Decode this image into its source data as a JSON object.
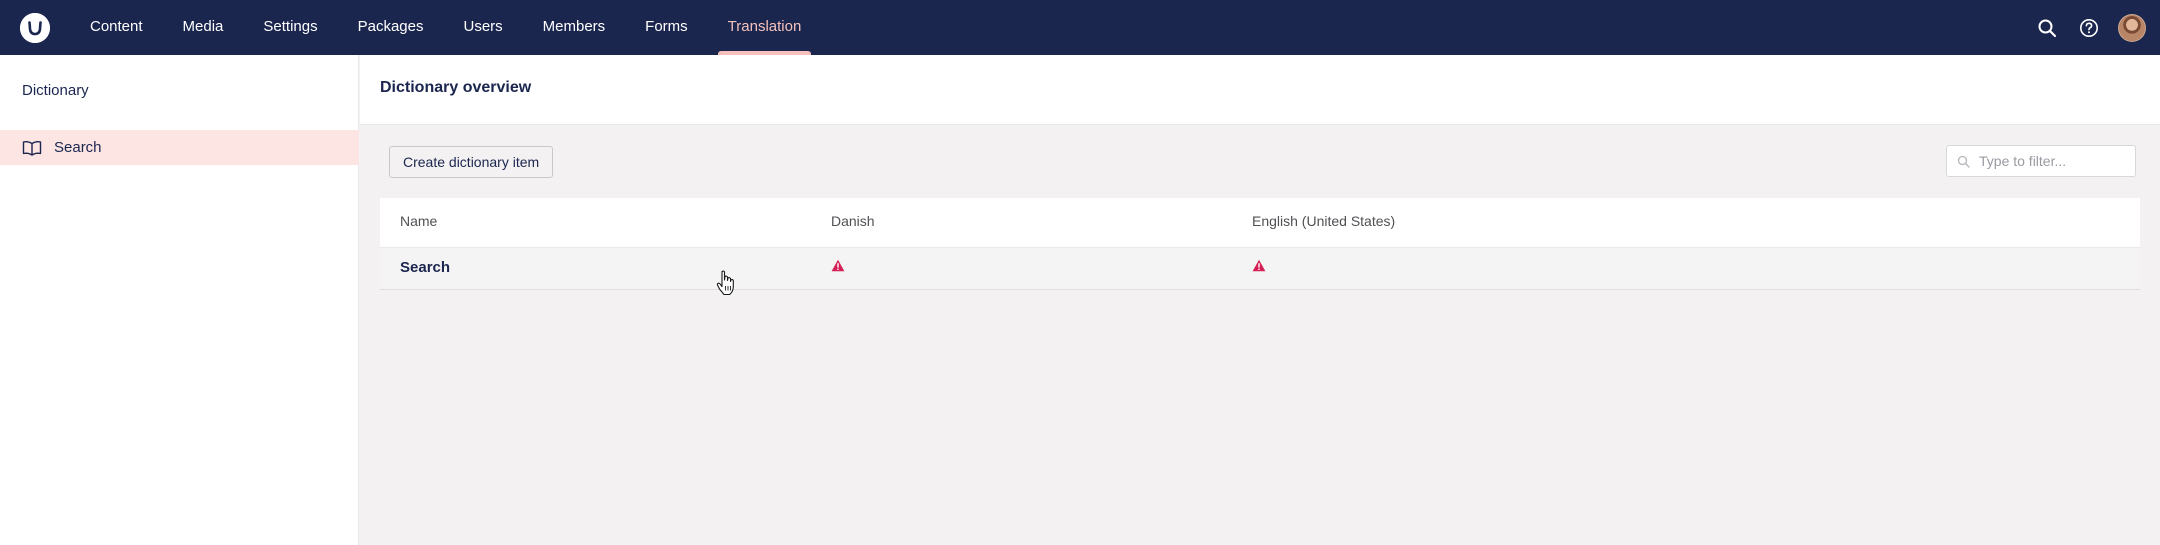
{
  "topbar": {
    "logo_icon": "umbraco-logo-icon",
    "nav": [
      {
        "label": "Content"
      },
      {
        "label": "Media"
      },
      {
        "label": "Settings"
      },
      {
        "label": "Packages"
      },
      {
        "label": "Users"
      },
      {
        "label": "Members"
      },
      {
        "label": "Forms"
      },
      {
        "label": "Translation",
        "active": true
      }
    ],
    "icons": [
      "search-icon",
      "help-icon",
      "avatar"
    ]
  },
  "sidebar": {
    "title": "Dictionary",
    "items": [
      {
        "label": "Search",
        "icon": "book-icon",
        "selected": true
      }
    ]
  },
  "main": {
    "title": "Dictionary overview",
    "create_button": "Create dictionary item",
    "filter": {
      "placeholder": "Type to filter...",
      "value": ""
    },
    "table": {
      "columns": [
        "Name",
        "Danish",
        "English (United States)"
      ],
      "rows": [
        {
          "name": "Search",
          "danish": "warning-icon",
          "english": "warning-icon"
        }
      ]
    }
  },
  "colors": {
    "topbar": "#1b264f",
    "active_nav": "#f5c1bc",
    "selected_sidebar": "#fce5e3",
    "warning": "#d42054"
  }
}
